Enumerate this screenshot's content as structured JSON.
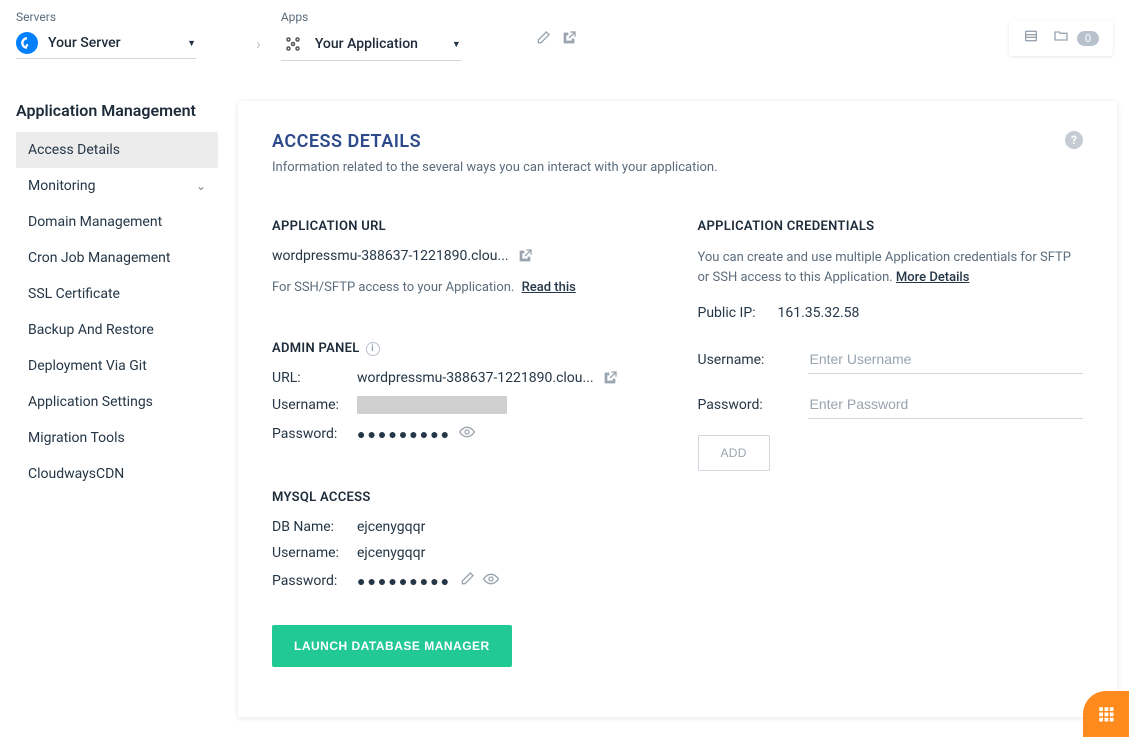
{
  "breadcrumb": {
    "servers_label": "Servers",
    "server_name": "Your Server",
    "apps_label": "Apps",
    "app_name": "Your Application"
  },
  "top_right": {
    "badge_count": "0"
  },
  "sidebar": {
    "heading": "Application Management",
    "items": [
      {
        "label": "Access Details",
        "active": true
      },
      {
        "label": "Monitoring",
        "expandable": true
      },
      {
        "label": "Domain Management"
      },
      {
        "label": "Cron Job Management"
      },
      {
        "label": "SSL Certificate"
      },
      {
        "label": "Backup And Restore"
      },
      {
        "label": "Deployment Via Git"
      },
      {
        "label": "Application Settings"
      },
      {
        "label": "Migration Tools"
      },
      {
        "label": "CloudwaysCDN"
      }
    ]
  },
  "panel": {
    "title": "ACCESS DETAILS",
    "subtitle": "Information related to the several ways you can interact with your application."
  },
  "app_url": {
    "heading": "APPLICATION URL",
    "url": "wordpressmu-388637-1221890.clou...",
    "note_prefix": "For SSH/SFTP access to your Application.",
    "note_link": "Read this"
  },
  "admin_panel": {
    "heading": "ADMIN PANEL",
    "url_label": "URL:",
    "url": "wordpressmu-388637-1221890.clou...",
    "username_label": "Username:",
    "password_label": "Password:",
    "password_dots": "●●●●●●●●●"
  },
  "mysql": {
    "heading": "MYSQL ACCESS",
    "dbname_label": "DB Name:",
    "dbname": "ejcenygqqr",
    "username_label": "Username:",
    "username": "ejcenygqqr",
    "password_label": "Password:",
    "password_dots": "●●●●●●●●●",
    "launch_button": "LAUNCH DATABASE MANAGER"
  },
  "credentials": {
    "heading": "APPLICATION CREDENTIALS",
    "note": "You can create and use multiple Application credentials for SFTP or SSH access to this Application.",
    "more_link": "More Details",
    "public_ip_label": "Public IP:",
    "public_ip": "161.35.32.58",
    "username_label": "Username:",
    "username_placeholder": "Enter Username",
    "password_label": "Password:",
    "password_placeholder": "Enter Password",
    "add_button": "ADD"
  }
}
